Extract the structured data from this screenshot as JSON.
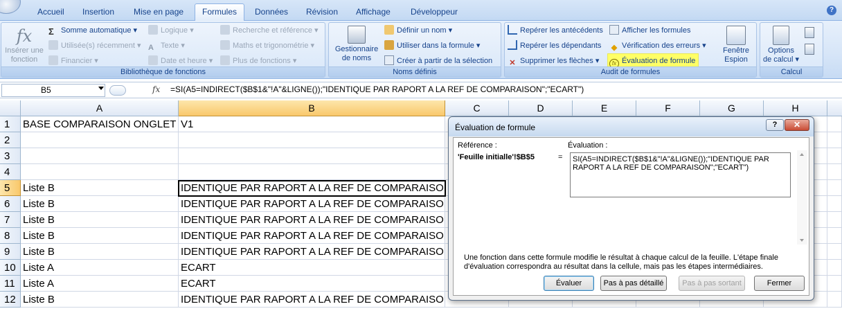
{
  "tabs": [
    "Accueil",
    "Insertion",
    "Mise en page",
    "Formules",
    "Données",
    "Révision",
    "Affichage",
    "Développeur"
  ],
  "active_tab": "Formules",
  "ribbon": {
    "lib": {
      "insert_function": [
        "Insérer une",
        "fonction"
      ],
      "autosum": "Somme automatique",
      "recent": "Utilisée(s) récemment",
      "financial": "Financier",
      "logical": "Logique",
      "text": "Texte",
      "datetime": "Date et heure",
      "lookup": "Recherche et référence",
      "math": "Maths et trigonométrie",
      "more": "Plus de fonctions",
      "label": "Bibliothèque de fonctions"
    },
    "names": {
      "manager": [
        "Gestionnaire",
        "de noms"
      ],
      "define": "Définir un nom",
      "use": "Utiliser dans la formule",
      "create": "Créer à partir de la sélection",
      "label": "Noms définis"
    },
    "audit": {
      "precedents": "Repérer les antécédents",
      "dependents": "Repérer les dépendants",
      "remove_arrows": "Supprimer les flèches",
      "show_formulas": "Afficher les formules",
      "error_check": "Vérification des erreurs",
      "evaluate": "Évaluation de formule",
      "watch": [
        "Fenêtre",
        "Espion"
      ],
      "label": "Audit de formules"
    },
    "calc": {
      "options": [
        "Options",
        "de calcul"
      ],
      "label": "Calcul"
    }
  },
  "formula_bar": {
    "name_box": "B5",
    "fx": "fx",
    "formula": "=SI(A5=INDIRECT($B$1&\"!A\"&LIGNE());\"IDENTIQUE PAR RAPORT A LA REF DE COMPARAISON\";\"ECART\")"
  },
  "columns": [
    "A",
    "B",
    "C",
    "D",
    "E",
    "F",
    "G",
    "H"
  ],
  "rows": [
    {
      "n": "1",
      "a": "BASE COMPARAISON ONGLET",
      "b": "V1"
    },
    {
      "n": "2",
      "a": "",
      "b": ""
    },
    {
      "n": "3",
      "a": "",
      "b": ""
    },
    {
      "n": "4",
      "a": "",
      "b": ""
    },
    {
      "n": "5",
      "a": "Liste B",
      "b": "IDENTIQUE PAR RAPORT A LA REF DE COMPARAISON"
    },
    {
      "n": "6",
      "a": "Liste B",
      "b": "IDENTIQUE PAR RAPORT A LA REF DE COMPARAISON"
    },
    {
      "n": "7",
      "a": "Liste B",
      "b": "IDENTIQUE PAR RAPORT A LA REF DE COMPARAISON"
    },
    {
      "n": "8",
      "a": "Liste B",
      "b": "IDENTIQUE PAR RAPORT A LA REF DE COMPARAISON"
    },
    {
      "n": "9",
      "a": "Liste B",
      "b": "IDENTIQUE PAR RAPORT A LA REF DE COMPARAISON"
    },
    {
      "n": "10",
      "a": "Liste A",
      "b": "ECART"
    },
    {
      "n": "11",
      "a": "Liste A",
      "b": "ECART"
    },
    {
      "n": "12",
      "a": "Liste B",
      "b": "IDENTIQUE PAR RAPORT A LA REF DE COMPARAISON"
    }
  ],
  "dialog": {
    "title": "Évaluation de formule",
    "help": "?",
    "close": "✕",
    "ref_label": "Référence :",
    "ref_value": "'Feuille initialle'!$B$5",
    "equals": "=",
    "eval_label": "Évaluation :",
    "eval_value": "SI(A5=INDIRECT($B$1&\"!A\"&LIGNE());\"IDENTIQUE PAR RAPORT A LA REF DE COMPARAISON\";\"ECART\")",
    "note": "Une fonction dans cette formule modifie le résultat à chaque calcul de la feuille. L'étape finale d'évaluation correspondra au résultat dans la cellule, mais pas les étapes intermédiaires.",
    "buttons": {
      "evaluate": "Évaluer",
      "step_in": "Pas à pas détaillé",
      "step_out": "Pas à pas sortant",
      "close": "Fermer"
    }
  }
}
